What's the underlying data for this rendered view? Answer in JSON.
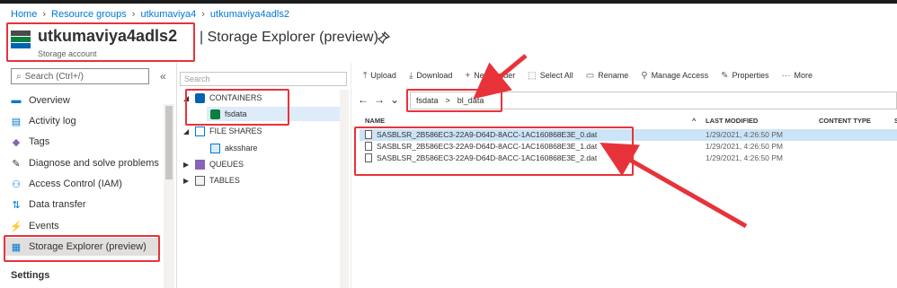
{
  "breadcrumb": [
    "Home",
    "Resource groups",
    "utkumaviya4",
    "utkumaviya4adls2"
  ],
  "header": {
    "resource_name": "utkumaviya4adls2",
    "page_suffix": "| Storage Explorer (preview)",
    "subtitle": "Storage account"
  },
  "nav": {
    "search_placeholder": "Search (Ctrl+/)",
    "collapse": "«",
    "items": [
      {
        "label": "Overview",
        "icon": "overview-icon"
      },
      {
        "label": "Activity log",
        "icon": "activity-log-icon"
      },
      {
        "label": "Tags",
        "icon": "tag-icon"
      },
      {
        "label": "Diagnose and solve problems",
        "icon": "wrench-icon"
      },
      {
        "label": "Access Control (IAM)",
        "icon": "people-icon"
      },
      {
        "label": "Data transfer",
        "icon": "data-transfer-icon"
      },
      {
        "label": "Events",
        "icon": "lightning-icon"
      },
      {
        "label": "Storage Explorer (preview)",
        "icon": "storage-explorer-icon"
      }
    ],
    "section": "Settings"
  },
  "tree": {
    "search_placeholder": "Search",
    "containers": "CONTAINERS",
    "container_child": "fsdata",
    "file_shares": "FILE SHARES",
    "file_share_child": "aksshare",
    "queues": "QUEUES",
    "tables": "TABLES"
  },
  "toolbar": {
    "upload": "Upload",
    "download": "Download",
    "new_folder": "New Folder",
    "select_all": "Select All",
    "rename": "Rename",
    "manage_access": "Manage Access",
    "properties": "Properties",
    "more": "More"
  },
  "address": {
    "segments": [
      "fsdata",
      "bl_data"
    ],
    "separator": ">"
  },
  "grid": {
    "columns": {
      "name": "NAME",
      "modified": "LAST MODIFIED",
      "content_type": "CONTENT TYPE",
      "size": "S"
    },
    "rows": [
      {
        "name": "SASBLSR_2B586EC3-22A9-D64D-8ACC-1AC160868E3E_0.dat",
        "modified": "1/29/2021, 4:26:50 PM"
      },
      {
        "name": "SASBLSR_2B586EC3-22A9-D64D-8ACC-1AC160868E3E_1.dat",
        "modified": "1/29/2021, 4:26:50 PM"
      },
      {
        "name": "SASBLSR_2B586EC3-22A9-D64D-8ACC-1AC160868E3E_2.dat",
        "modified": "1/29/2021, 4:26:50 PM"
      }
    ]
  },
  "colors": {
    "link": "#0078d4",
    "annotation": "#e8323a",
    "selection": "#cce4f7"
  }
}
